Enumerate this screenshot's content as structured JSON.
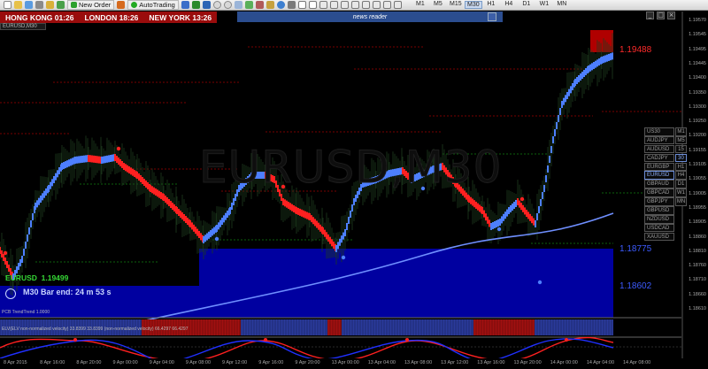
{
  "toolbar": {
    "new_order": "New Order",
    "auto_trading": "AutoTrading",
    "timeframes": [
      "M1",
      "M5",
      "M15",
      "M30",
      "H1",
      "H4",
      "D1",
      "W1",
      "MN"
    ],
    "active_timeframe": "M30"
  },
  "clocks": [
    {
      "city": "HONG KONG",
      "time": "01:26"
    },
    {
      "city": "LONDON",
      "time": "18:26"
    },
    {
      "city": "NEW YORK",
      "time": "13:26"
    }
  ],
  "chart_tab": "EURUSD,M30",
  "news_reader": "news reader",
  "window_controls": [
    "_",
    "□",
    "×"
  ],
  "watermark": "EURUSD,M30",
  "pair_info": {
    "symbol": "EURUSD",
    "price": "1.19499"
  },
  "bar_end": "M30 Bar end: 24 m 53 s",
  "levels": {
    "top_label": "1.19488",
    "mid_label": "1.18775",
    "low_label": "1.18602"
  },
  "price_axis": [
    "1.19570",
    "1.19545",
    "1.19495",
    "1.19445",
    "1.19400",
    "1.19350",
    "1.19300",
    "1.19250",
    "1.19200",
    "1.19155",
    "1.19105",
    "1.19055",
    "1.19005",
    "1.18955",
    "1.18905",
    "1.18860",
    "1.18810",
    "1.18760",
    "1.18710",
    "1.18660",
    "1.18610"
  ],
  "time_axis": [
    "8 Apr 2015",
    "8 Apr 16:00",
    "8 Apr 20:00",
    "9 Apr 00:00",
    "9 Apr 04:00",
    "9 Apr 08:00",
    "9 Apr 12:00",
    "9 Apr 16:00",
    "9 Apr 20:00",
    "13 Apr 00:00",
    "13 Apr 04:00",
    "13 Apr 08:00",
    "13 Apr 12:00",
    "13 Apr 16:00",
    "13 Apr 20:00",
    "14 Apr 00:00",
    "14 Apr 04:00",
    "14 Apr 08:00"
  ],
  "symbol_list": [
    {
      "name": "US30",
      "tf": "M1"
    },
    {
      "name": "AUDJPY",
      "tf": "M5"
    },
    {
      "name": "AUDUSD",
      "tf": "15"
    },
    {
      "name": "CADJPY",
      "tf": "30"
    },
    {
      "name": "EURGBP",
      "tf": "H1"
    },
    {
      "name": "EURUSD",
      "tf": "H4"
    },
    {
      "name": "GBPAUD",
      "tf": "D1"
    },
    {
      "name": "GBPCAD",
      "tf": "W1"
    },
    {
      "name": "GBPJPY",
      "tf": "MN"
    },
    {
      "name": "GBPUSD",
      "tf": ""
    },
    {
      "name": "NZDUSD",
      "tf": ""
    },
    {
      "name": "USDCAD",
      "tf": ""
    },
    {
      "name": "XAUUSD",
      "tf": ""
    }
  ],
  "active_symbol": "EURUSD",
  "active_tf": "30",
  "indicator1_label": "PCB TrendTrend 1.0000",
  "indicator2_label": "ELV(ELV non-normalized velocity) 33.8399 33.8399 (non-normalized velocity) 66.4297 66.4297",
  "colors": {
    "bull": "#4d7fff",
    "bear": "#ff2020",
    "zone": "#0000a0",
    "ma": "#6f8fff",
    "clock_bg": "#9a0c0c",
    "news_bg": "#2b4d8f",
    "price_text": "#35d735"
  },
  "icons": [
    "new-file-icon",
    "folder-icon",
    "profile-icon",
    "terminal-icon",
    "navigator-icon",
    "zoom-in-icon",
    "zoom-out-icon",
    "crosshair-icon",
    "line-icon"
  ]
}
